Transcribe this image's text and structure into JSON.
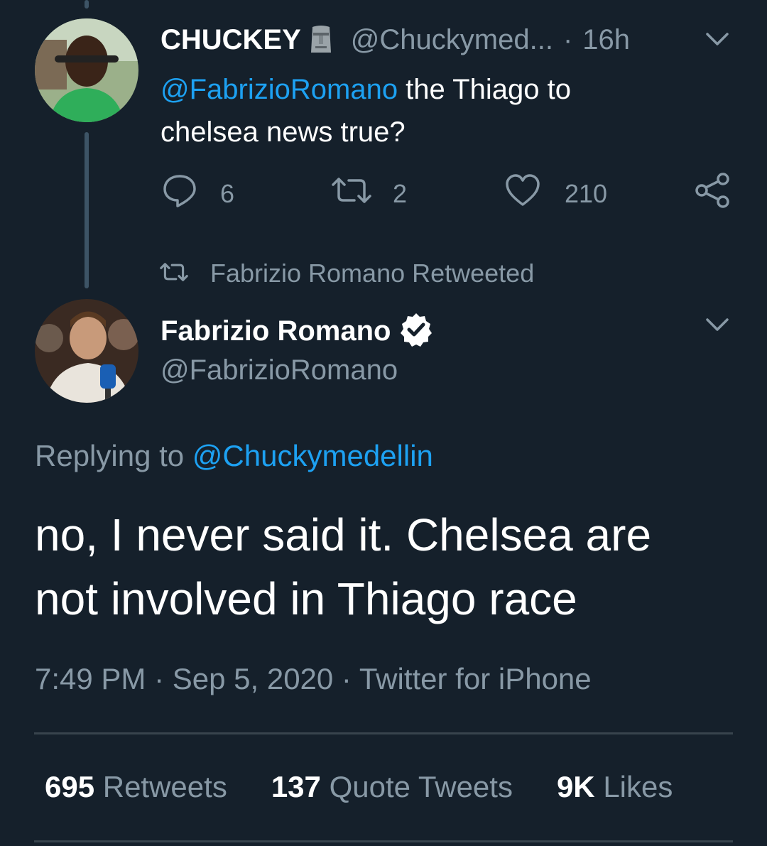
{
  "reply_tweet": {
    "display_name": "CHUCKEY",
    "emoji": "moai",
    "handle": "@Chuckymed...",
    "time_sep": "·",
    "time": "16h",
    "mention": "@FabrizioRomano",
    "text_line1": " the Thiago to",
    "text_line2": "chelsea news true?",
    "replies": "6",
    "retweets": "2",
    "likes": "210"
  },
  "retweet_notice": "Fabrizio Romano Retweeted",
  "main_tweet": {
    "display_name": "Fabrizio Romano",
    "handle": "@FabrizioRomano",
    "replying_prefix": "Replying to ",
    "replying_to": "@Chuckymedellin",
    "text_line1": "no, I never said it. Chelsea are",
    "text_line2": "not involved in Thiago race",
    "meta": "7:49 PM · Sep 5, 2020 · Twitter for iPhone"
  },
  "stats": {
    "retweets_count": "695",
    "retweets_label": " Retweets",
    "quotes_count": "137",
    "quotes_label": " Quote Tweets",
    "likes_count": "9K",
    "likes_label": " Likes"
  },
  "colors": {
    "background": "#15202b",
    "link": "#1da1f2",
    "muted": "#8899a6",
    "divider": "#38444d"
  }
}
